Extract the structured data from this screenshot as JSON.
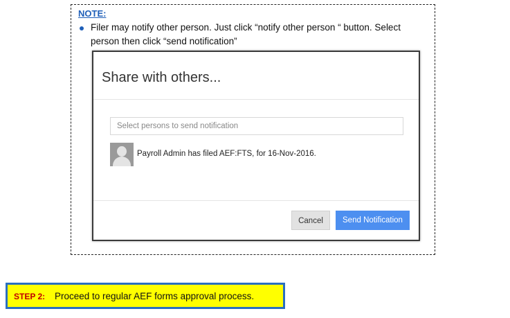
{
  "note": {
    "title": "NOTE:",
    "line1": "Filer may notify other person. Just click “notify other person “ button.  Select",
    "line2": "person then click “send notification”"
  },
  "dialog": {
    "title": "Share with others...",
    "select_placeholder": "Select persons to send notification",
    "feed_item": "Payroll Admin has filed AEF:FTS, for 16-Nov-2016.",
    "cancel_label": "Cancel",
    "send_label": "Send Notification",
    "colors": {
      "send_button": "#4d8ff0",
      "cancel_button": "#e2e2e2"
    }
  },
  "step": {
    "label": "STEP 2:",
    "text": "Proceed to regular AEF forms approval process.",
    "colors": {
      "background": "#ffff00",
      "border": "#2a6fc0",
      "label": "#c00000"
    }
  }
}
